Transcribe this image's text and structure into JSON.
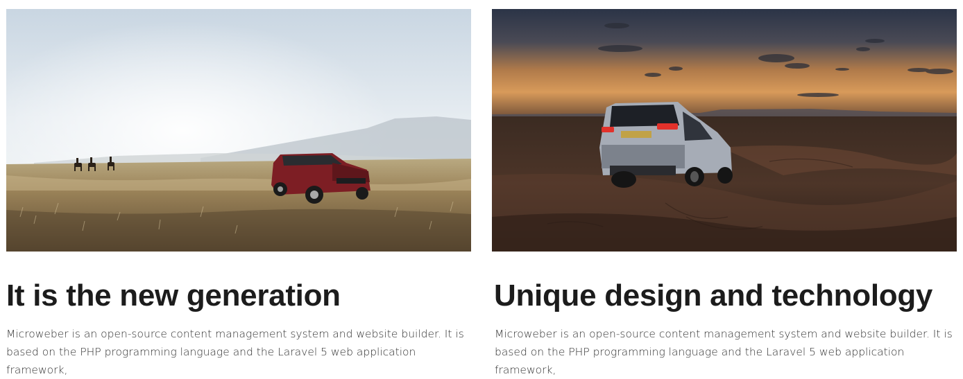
{
  "cards": [
    {
      "image_subject": "red SUV on grassland with horse riders",
      "title": "It is the new generation",
      "description": "Microweber is an open-source content management system and website builder. It is based on the PHP programming language and the Laravel 5 web application framework,"
    },
    {
      "image_subject": "white SUV on desert dunes at dusk",
      "title": "Unique design and technology",
      "description": "Microweber is an open-source content management system and website builder. It is based on the PHP programming language and the Laravel 5 web application framework,"
    }
  ]
}
